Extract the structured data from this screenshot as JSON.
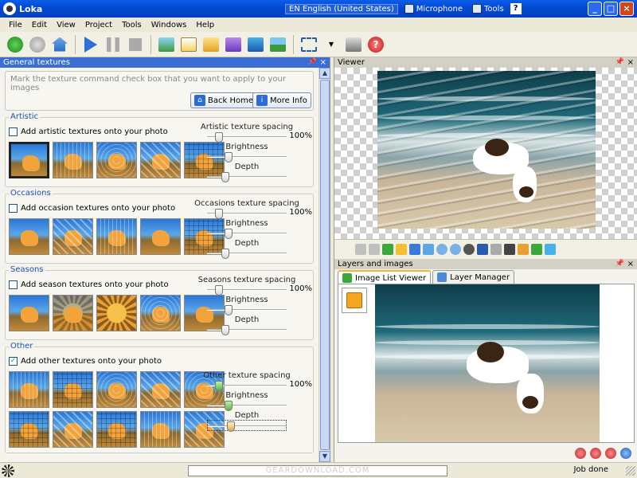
{
  "titlebar": {
    "title": "Loka",
    "language": "EN English (United States)",
    "microphone": "Microphone",
    "tools": "Tools",
    "help": "?"
  },
  "menu": [
    "File",
    "Edit",
    "View",
    "Project",
    "Tools",
    "Windows",
    "Help"
  ],
  "left_panel": {
    "title": "General textures",
    "intro": "Mark the texture command check box that you want to apply to your images",
    "back_home": "Back Home",
    "more_info": "More Info",
    "groups": [
      {
        "label": "Artistic",
        "checkbox": "Add artistic textures onto your photo",
        "checked": false,
        "spacing_label": "Artistic texture spacing",
        "spacing_value": "100%",
        "brightness_label": "Brightness",
        "depth_label": "Depth"
      },
      {
        "label": "Occasions",
        "checkbox": "Add occasion textures onto your photo",
        "checked": false,
        "spacing_label": "Occasions texture spacing",
        "spacing_value": "100%",
        "brightness_label": "Brightness",
        "depth_label": "Depth"
      },
      {
        "label": "Seasons",
        "checkbox": "Add season textures onto your photo",
        "checked": false,
        "spacing_label": "Seasons texture spacing",
        "spacing_value": "100%",
        "brightness_label": "Brightness",
        "depth_label": "Depth"
      },
      {
        "label": "Other",
        "checkbox": "Add other textures onto your photo",
        "checked": true,
        "spacing_label": "Other texture spacing",
        "spacing_value": "100%",
        "brightness_label": "Brightness",
        "depth_label": "Depth"
      }
    ]
  },
  "viewer": {
    "title": "Viewer"
  },
  "layers": {
    "title": "Layers and images",
    "tab_image_list": "Image List Viewer",
    "tab_layer_manager": "Layer Manager"
  },
  "status": {
    "watermark": "GEARDOWNLOAD.COM",
    "text": "Job done"
  },
  "colors": {
    "title_bar": "#0549d4",
    "panel_header_active": "#3a6ed4",
    "group_label": "#1e4fb0"
  }
}
